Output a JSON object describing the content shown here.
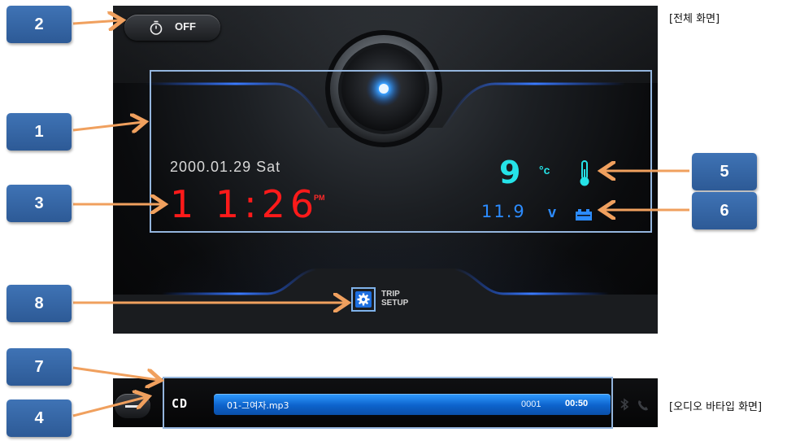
{
  "screen": {
    "timer": {
      "state": "OFF",
      "icon": "stopwatch-icon"
    },
    "date": "2000.01.29  Sat",
    "clock": {
      "time": "1 1:26",
      "ampm": "PM"
    },
    "temperature": {
      "value": "9",
      "unit": "°c",
      "icon": "thermometer-icon"
    },
    "voltage": {
      "value": "11.9",
      "unit": "v",
      "icon": "battery-icon"
    },
    "trip_setup": {
      "line1": "TRIP",
      "line2": "SETUP",
      "icon": "gear-icon"
    }
  },
  "captions": {
    "full_screen": "[전체 화면]",
    "audio_bar": "[오디오 바타입 화면]"
  },
  "callouts": [
    "1",
    "2",
    "3",
    "4",
    "5",
    "6",
    "7",
    "8"
  ],
  "audio_bar": {
    "source": "CD",
    "track_name": "01-그여자.mp3",
    "track_number": "0001",
    "elapsed": "00:50"
  },
  "colors": {
    "callout_blue": "#3f73b5",
    "arrow_orange": "#f0a05e",
    "frame_blue": "#94b5dd",
    "clock_red": "#ff1a1a",
    "temp_cyan": "#25e3e8",
    "volt_blue": "#2c8cff",
    "audio_blue": "#1a7be8"
  }
}
